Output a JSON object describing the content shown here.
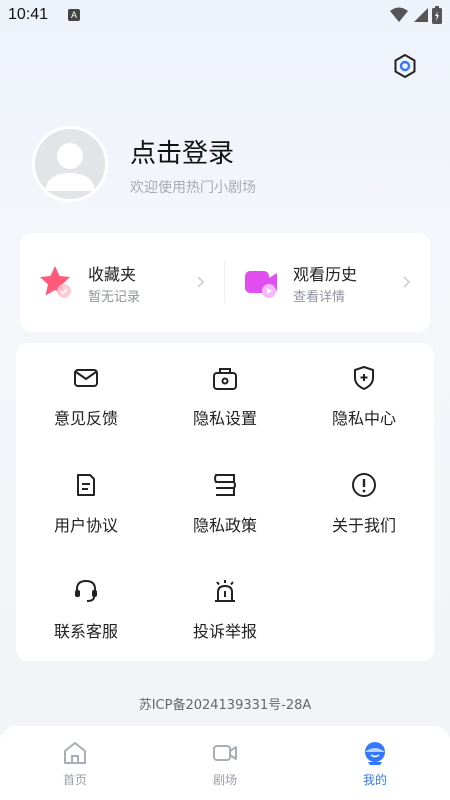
{
  "status_bar": {
    "time": "10:41",
    "notification_badge": "A",
    "icons": [
      "wifi-icon",
      "signal-icon",
      "battery-icon"
    ]
  },
  "header": {
    "settings_icon": "hexagon-settings-icon"
  },
  "profile": {
    "title": "点击登录",
    "subtitle": "欢迎使用热门小剧场",
    "avatar_icon": "default-avatar-icon"
  },
  "quick_cards": [
    {
      "title": "收藏夹",
      "subtitle": "暂无记录",
      "icon": "star-icon",
      "color": "#ff5a7a"
    },
    {
      "title": "观看历史",
      "subtitle": "查看详情",
      "icon": "video-camera-icon",
      "color": "#e24ff0"
    }
  ],
  "menu": [
    {
      "label": "意见反馈",
      "icon": "mail-icon"
    },
    {
      "label": "隐私设置",
      "icon": "lock-bag-icon"
    },
    {
      "label": "隐私中心",
      "icon": "shield-plus-icon"
    },
    {
      "label": "用户协议",
      "icon": "document-icon"
    },
    {
      "label": "隐私政策",
      "icon": "policy-icon"
    },
    {
      "label": "关于我们",
      "icon": "info-exclamation-icon"
    },
    {
      "label": "联系客服",
      "icon": "headset-icon"
    },
    {
      "label": "投诉举报",
      "icon": "alarm-icon"
    }
  ],
  "footer": {
    "icp": "苏ICP备2024139331号-28A"
  },
  "tabs": [
    {
      "label": "首页",
      "icon": "home-icon",
      "active": false
    },
    {
      "label": "剧场",
      "icon": "video-icon",
      "active": false
    },
    {
      "label": "我的",
      "icon": "profile-mascot-icon",
      "active": true
    }
  ],
  "colors": {
    "accent": "#3377ff",
    "text_primary": "#222222",
    "text_secondary": "#8f939c"
  }
}
